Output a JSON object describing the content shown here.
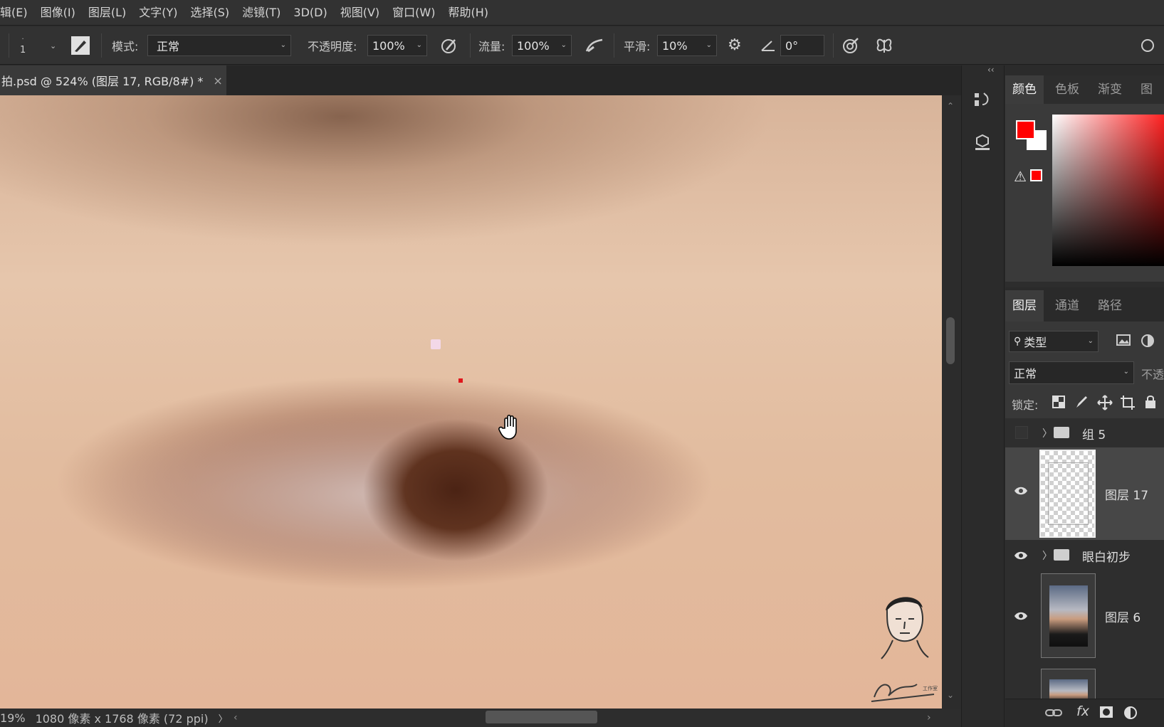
{
  "menu": [
    "辑(E)",
    "图像(I)",
    "图层(L)",
    "文字(Y)",
    "选择(S)",
    "滤镜(T)",
    "3D(D)",
    "视图(V)",
    "窗口(W)",
    "帮助(H)"
  ],
  "options": {
    "brush_size": "1",
    "mode_label": "模式:",
    "mode_value": "正常",
    "opacity_label": "不透明度:",
    "opacity_value": "100%",
    "flow_label": "流量:",
    "flow_value": "100%",
    "smooth_label": "平滑:",
    "smooth_value": "10%",
    "angle_value": "0°"
  },
  "document": {
    "tab_title": "拍.psd @ 524% (图层 17, RGB/8#) *",
    "close_glyph": "×"
  },
  "status": {
    "zoom": "19%",
    "dimensions": "1080 像素 x 1768 像素 (72 ppi)",
    "arrow": "〉"
  },
  "color_panel": {
    "tabs": [
      "颜色",
      "色板",
      "渐变",
      "图案"
    ],
    "active_tab": 0,
    "foreground": "#ff0000",
    "background": "#ffffff"
  },
  "layers_panel": {
    "tabs": [
      "图层",
      "通道",
      "路径"
    ],
    "active_tab": 0,
    "filter_label": "类型",
    "blend_mode": "正常",
    "opacity_label": "不透",
    "lock_label": "锁定:",
    "layers": [
      {
        "name": "组 5",
        "kind": "group",
        "visible": false
      },
      {
        "name": "图层 17",
        "kind": "pixel",
        "visible": true,
        "selected": true
      },
      {
        "name": "眼白初步",
        "kind": "group",
        "visible": true
      },
      {
        "name": "图层 6",
        "kind": "photo",
        "visible": true
      }
    ]
  },
  "watermark": {
    "studio": "工作室"
  }
}
